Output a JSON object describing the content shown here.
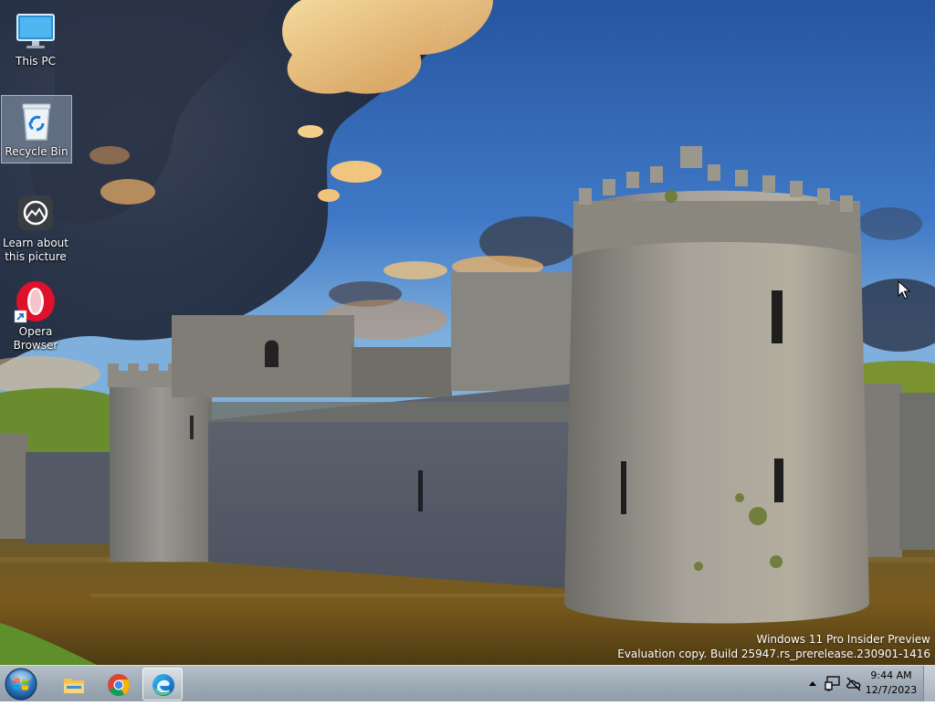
{
  "desktop": {
    "icons": [
      {
        "label": "This PC",
        "icon": "monitor-icon"
      },
      {
        "label": "Recycle Bin",
        "icon": "recycle-bin-icon"
      },
      {
        "label": "Learn about this picture",
        "icon": "camera-icon"
      },
      {
        "label": "Opera Browser",
        "icon": "opera-icon"
      }
    ]
  },
  "watermark": {
    "line1": "Windows 11 Pro Insider Preview",
    "line2": "Evaluation copy. Build 25947.rs_prerelease.230901-1416"
  },
  "taskbar": {
    "start_icon": "windows-start-orb-icon",
    "pinned": [
      {
        "name": "File Explorer",
        "icon": "folder-icon"
      },
      {
        "name": "Google Chrome",
        "icon": "chrome-icon"
      },
      {
        "name": "Microsoft Edge",
        "icon": "edge-icon",
        "active": true
      }
    ],
    "tray": {
      "time": "9:44 AM",
      "date": "12/7/2023",
      "icons": [
        "chevron-up-icon",
        "network-icon",
        "onedrive-offline-icon"
      ]
    }
  },
  "colors": {
    "sky_top": "#2f5fa8",
    "taskbar": "#a4afb9",
    "castle_stone": "#8b8b86"
  }
}
